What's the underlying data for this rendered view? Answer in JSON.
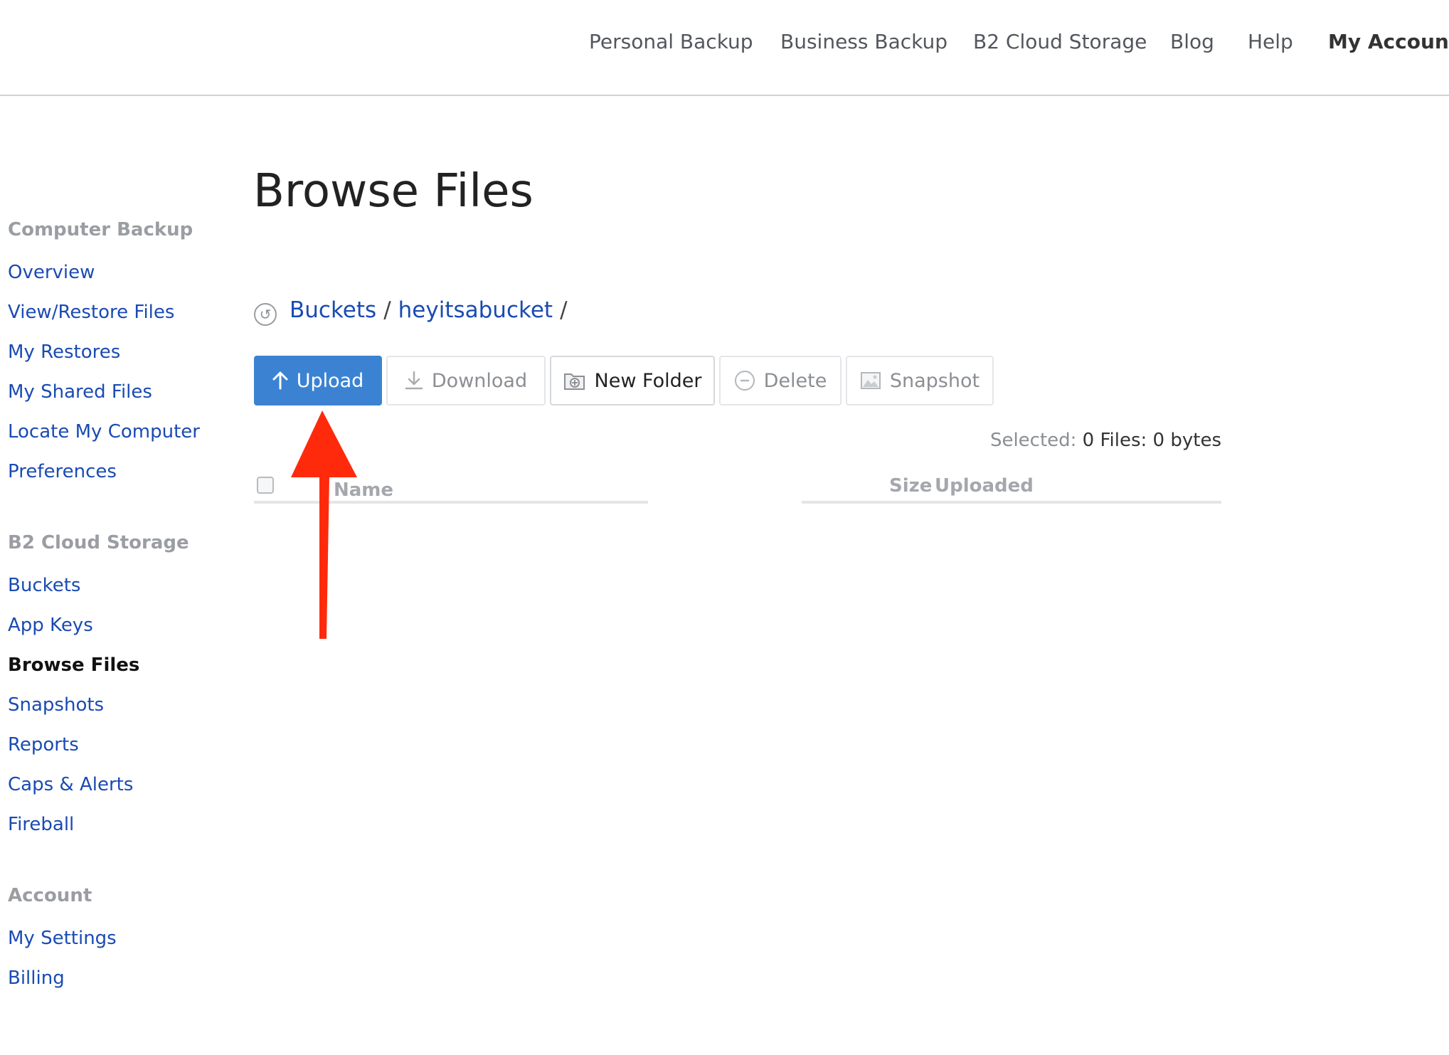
{
  "topnav": {
    "items": [
      {
        "label": "Personal Backup"
      },
      {
        "label": "Business Backup"
      },
      {
        "label": "B2 Cloud Storage"
      },
      {
        "label": "Blog"
      },
      {
        "label": "Help"
      },
      {
        "label": "My Account",
        "active": true
      }
    ]
  },
  "sidebar": {
    "sections": [
      {
        "heading": "Computer Backup",
        "items": [
          "Overview",
          "View/Restore Files",
          "My Restores",
          "My Shared Files",
          "Locate My Computer",
          "Preferences"
        ]
      },
      {
        "heading": "B2 Cloud Storage",
        "items": [
          "Buckets",
          "App Keys",
          "Browse Files",
          "Snapshots",
          "Reports",
          "Caps & Alerts",
          "Fireball"
        ]
      },
      {
        "heading": "Account",
        "items": [
          "My Settings",
          "Billing"
        ]
      }
    ],
    "current": "Browse Files"
  },
  "main": {
    "title": "Browse Files",
    "breadcrumb": {
      "root": "Buckets",
      "separator": "/",
      "bucket": "heyitsabucket",
      "trailing": "/"
    },
    "toolbar": {
      "upload": "Upload",
      "download": "Download",
      "new_folder": "New Folder",
      "delete": "Delete",
      "snapshot": "Snapshot"
    },
    "selection": {
      "label": "Selected:",
      "value": "0 Files: 0 bytes"
    },
    "table": {
      "columns": {
        "name": "Name",
        "size": "Size",
        "uploaded": "Uploaded"
      }
    }
  },
  "colors": {
    "link": "#1a4bb3",
    "primary_button": "#3b83d2",
    "annotation_arrow": "#ff2a0c"
  }
}
